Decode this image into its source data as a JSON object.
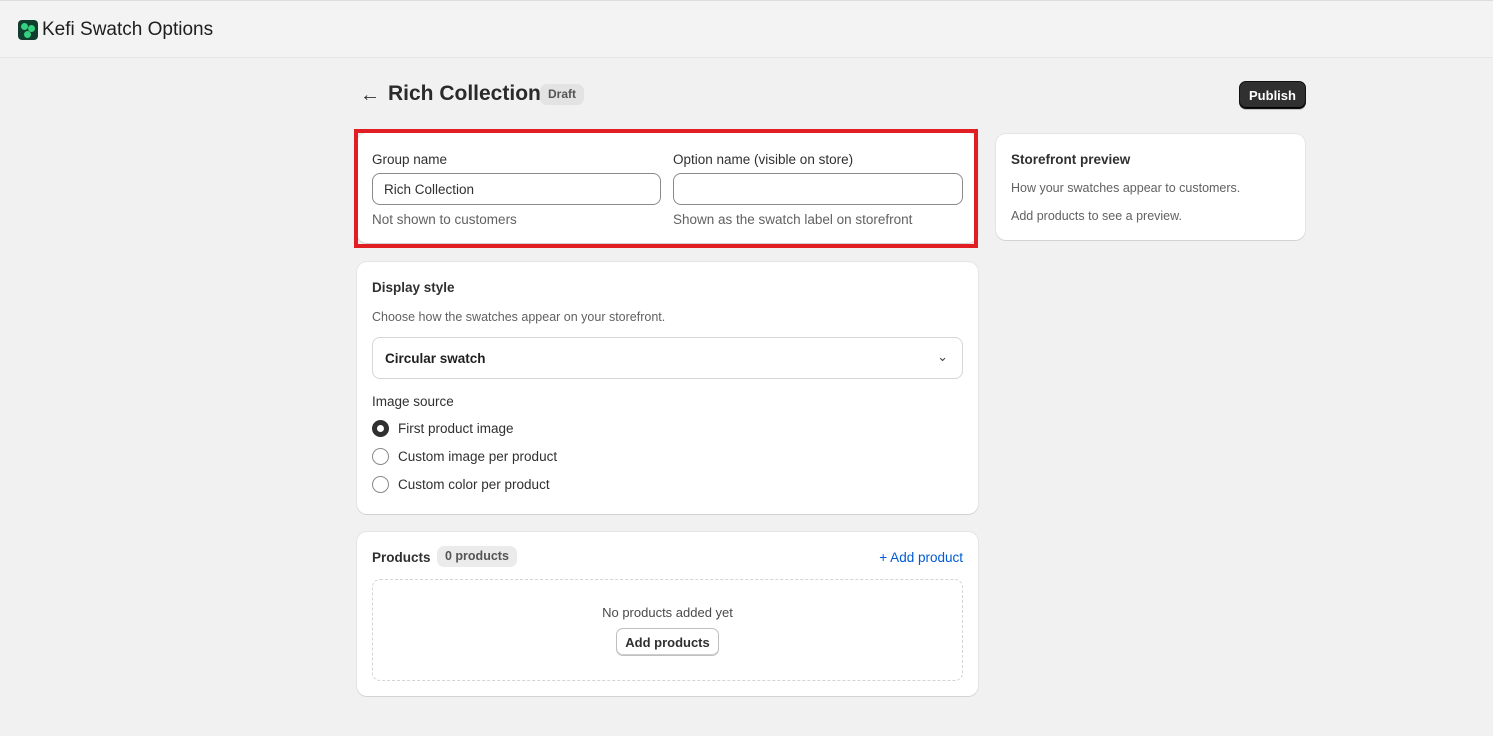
{
  "app": {
    "title": "Kefi Swatch Options"
  },
  "header": {
    "title": "Rich Collection",
    "status": "Draft",
    "publish_label": "Publish"
  },
  "names": {
    "group_label": "Group name",
    "group_value": "Rich Collection",
    "group_help": "Not shown to customers",
    "option_label": "Option name (visible on store)",
    "option_value": "",
    "option_help": "Shown as the swatch label on storefront"
  },
  "display": {
    "title": "Display style",
    "subtitle": "Choose how the swatches appear on your storefront.",
    "selected": "Circular swatch",
    "image_source_label": "Image source",
    "options": [
      "First product image",
      "Custom image per product",
      "Custom color per product"
    ],
    "selected_option_index": 0
  },
  "products": {
    "title": "Products",
    "count": "0 products",
    "add_link": "+ Add product",
    "empty_text": "No products added yet",
    "add_button": "Add products"
  },
  "preview": {
    "title": "Storefront preview",
    "line1": "How your swatches appear to customers.",
    "line2": "Add products to see a preview."
  },
  "colors": {
    "accent": "#005bd3",
    "highlight": "#e01e23",
    "primary_button": "#303030"
  }
}
